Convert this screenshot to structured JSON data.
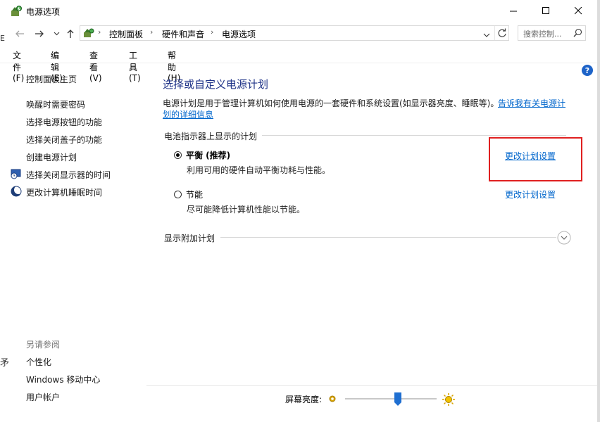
{
  "window": {
    "title": "电源选项",
    "minimize_icon": "minimize-icon",
    "maximize_icon": "maximize-icon",
    "close_icon": "close-icon"
  },
  "navigation": {
    "breadcrumb": [
      "控制面板",
      "硬件和声音",
      "电源选项"
    ],
    "search_placeholder": "搜索控制..."
  },
  "menu": [
    "文件(F)",
    "编辑(E)",
    "查看(V)",
    "工具(T)",
    "帮助(H)"
  ],
  "sidebar": {
    "home": "控制面板主页",
    "items": [
      {
        "label": "唤醒时需要密码",
        "icon": ""
      },
      {
        "label": "选择电源按钮的功能",
        "icon": ""
      },
      {
        "label": "选择关闭盖子的功能",
        "icon": ""
      },
      {
        "label": "创建电源计划",
        "icon": ""
      },
      {
        "label": "选择关闭显示器的时间",
        "icon": "monitor-clock-icon"
      },
      {
        "label": "更改计算机睡眠时间",
        "icon": "moon-icon"
      }
    ],
    "see_also_title": "另请参阅",
    "see_also": [
      "个性化",
      "Windows 移动中心",
      "用户帐户"
    ]
  },
  "main": {
    "heading": "选择或自定义电源计划",
    "description_line1": "电源计划是用于管理计算机如何使用电源的一套硬件和系统设置(如显示器亮度、睡眠等)。",
    "description_link1": "告诉我有关电源计",
    "description_link2": "划的详细信息",
    "section_title": "电池指示器上显示的计划",
    "plans": [
      {
        "name": "平衡 (推荐)",
        "description": "利用可用的硬件自动平衡功耗与性能。",
        "selected": true,
        "action": "更改计划设置"
      },
      {
        "name": "节能",
        "description": "尽可能降低计算机性能以节能。",
        "selected": false,
        "action": "更改计划设置"
      }
    ],
    "more_plans": "显示附加计划"
  },
  "brightness": {
    "label": "屏幕亮度:",
    "level": 0.58
  },
  "colors": {
    "link": "#0066cc",
    "heading": "#1e3287",
    "highlight_box": "#e02020",
    "slider_thumb": "#1f6fd1"
  }
}
